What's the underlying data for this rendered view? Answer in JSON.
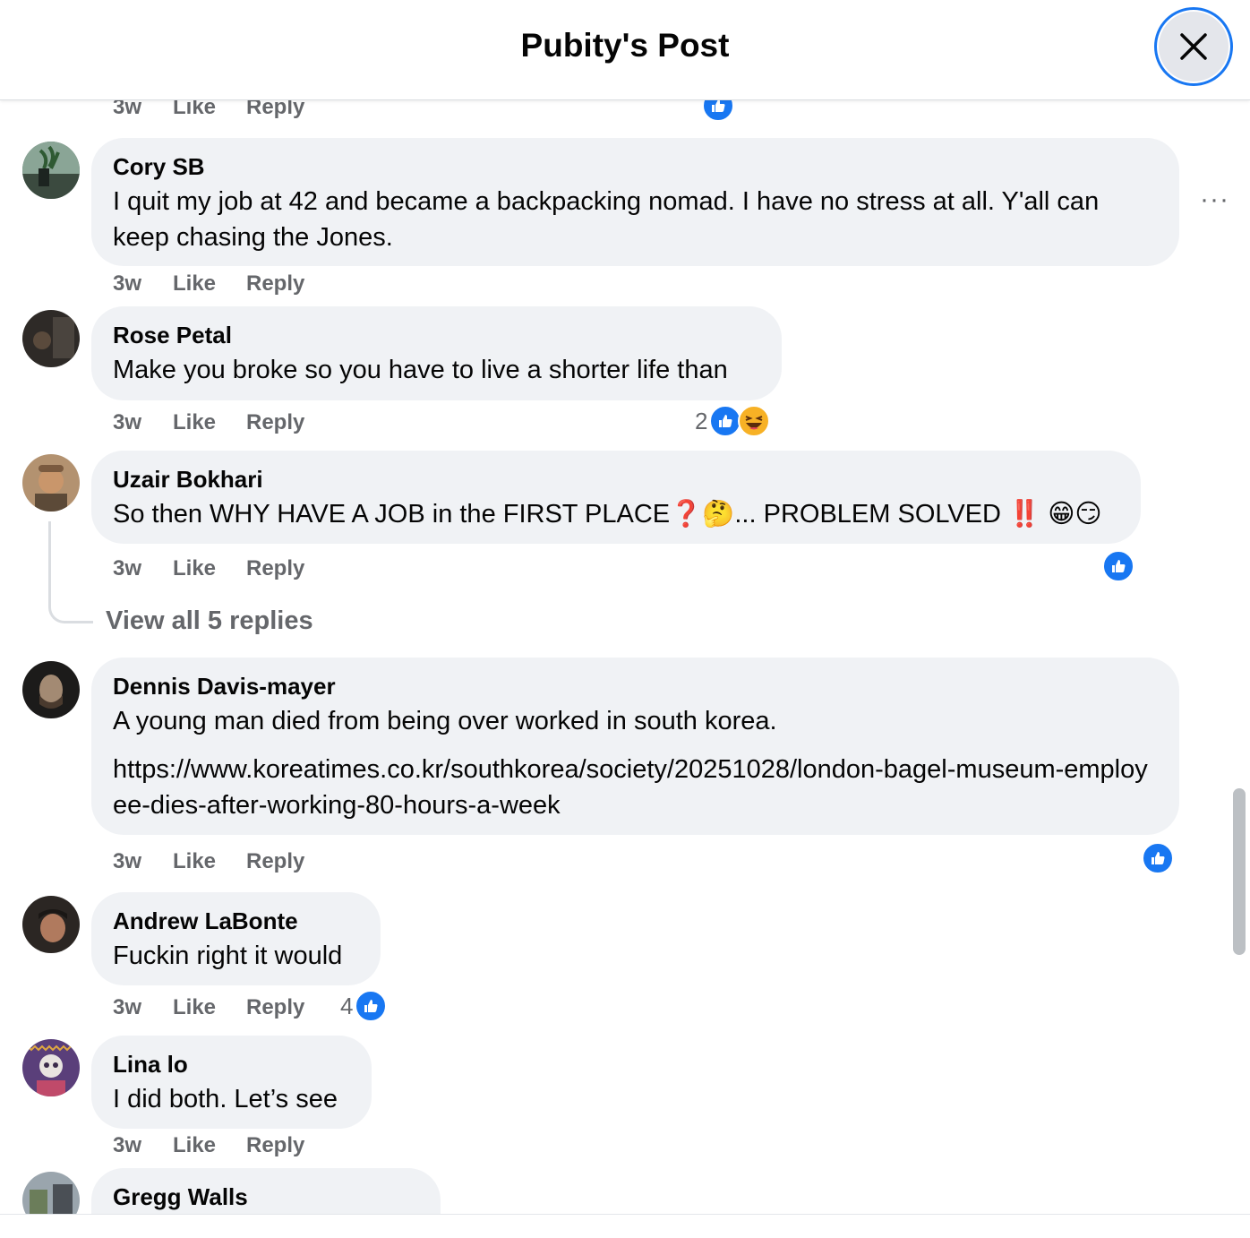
{
  "header": {
    "title": "Pubity's Post"
  },
  "top_meta": {
    "age": "3w",
    "like": "Like",
    "reply": "Reply"
  },
  "comments": [
    {
      "author": "Cory SB",
      "text": "I quit my job at 42 and became a backpacking nomad. I have no stress at all. Y'all can keep chasing the Jones.",
      "age": "3w",
      "like": "Like",
      "reply": "Reply",
      "more": "···"
    },
    {
      "author": "Rose Petal",
      "text": "Make you broke so you have to live a shorter life than",
      "age": "3w",
      "like": "Like",
      "reply": "Reply",
      "reaction_count": "2"
    },
    {
      "author": "Uzair Bokhari",
      "text": "So then WHY HAVE A JOB in the FIRST PLACE❓🤔... PROBLEM SOLVED ‼️ 😁😏",
      "age": "3w",
      "like": "Like",
      "reply": "Reply",
      "view_replies": "View all 5 replies"
    },
    {
      "author": "Dennis Davis-mayer",
      "text": "A young man died from being over worked in south korea.",
      "link": "https://www.koreatimes.co.kr/southkorea/society/20251028/london-bagel-museum-employee-dies-after-working-80-hours-a-week",
      "age": "3w",
      "like": "Like",
      "reply": "Reply"
    },
    {
      "author": "Andrew LaBonte",
      "text": "Fuckin right it would",
      "age": "3w",
      "like": "Like",
      "reply": "Reply",
      "reaction_count": "4"
    },
    {
      "author": "Lina lo",
      "text": "I did both. Let’s see",
      "age": "3w",
      "like": "Like",
      "reply": "Reply"
    },
    {
      "author": "Gregg Walls"
    }
  ],
  "colors": {
    "bubble": "#f0f2f5",
    "like_blue": "#1877f2",
    "meta_grey": "#65676b",
    "text": "#050505"
  },
  "icons": {
    "close": "close-icon",
    "like": "like-reaction-icon",
    "haha": "haha-reaction-icon",
    "more": "more-options-icon"
  }
}
